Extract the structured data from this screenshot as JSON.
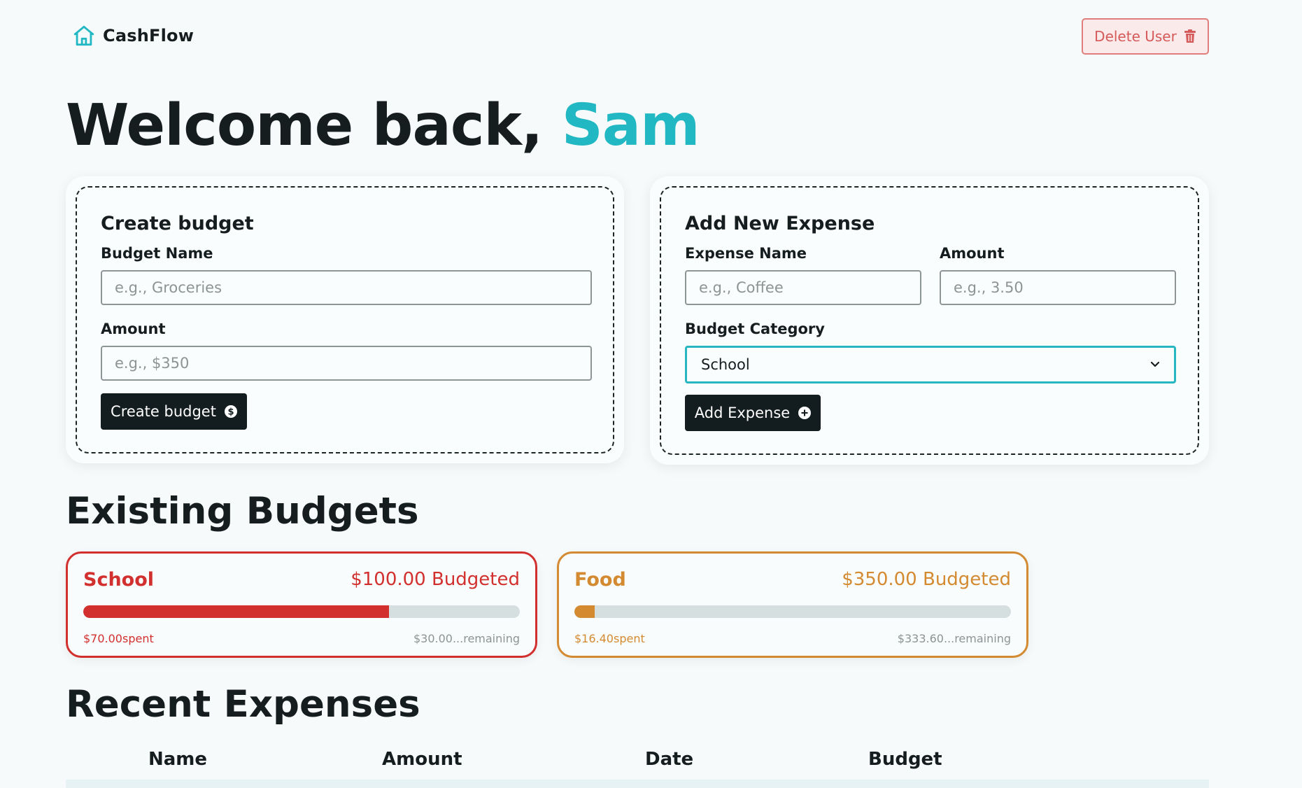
{
  "header": {
    "brand": "CashFlow",
    "delete_label": "Delete User"
  },
  "welcome": {
    "prefix": "Welcome back,",
    "name": "Sam"
  },
  "create_budget": {
    "title": "Create budget",
    "name_label": "Budget Name",
    "name_placeholder": "e.g., Groceries",
    "amount_label": "Amount",
    "amount_placeholder": "e.g., $350",
    "button_label": "Create budget"
  },
  "add_expense": {
    "title": "Add New Expense",
    "name_label": "Expense Name",
    "name_placeholder": "e.g., Coffee",
    "amount_label": "Amount",
    "amount_placeholder": "e.g., 3.50",
    "category_label": "Budget Category",
    "category_value": "School",
    "button_label": "Add Expense"
  },
  "existing_budgets": {
    "title": "Existing Budgets",
    "items": [
      {
        "name": "School",
        "budgeted": "$100.00 Budgeted",
        "spent": "$70.00spent",
        "remaining": "$30.00...remaining",
        "progress": 0.7,
        "color": "#d2302e"
      },
      {
        "name": "Food",
        "budgeted": "$350.00 Budgeted",
        "spent": "$16.40spent",
        "remaining": "$333.60...remaining",
        "progress": 0.047,
        "color": "#d38a30"
      }
    ]
  },
  "recent_expenses": {
    "title": "Recent Expenses",
    "columns": [
      "Name",
      "Amount",
      "Date",
      "Budget"
    ]
  }
}
